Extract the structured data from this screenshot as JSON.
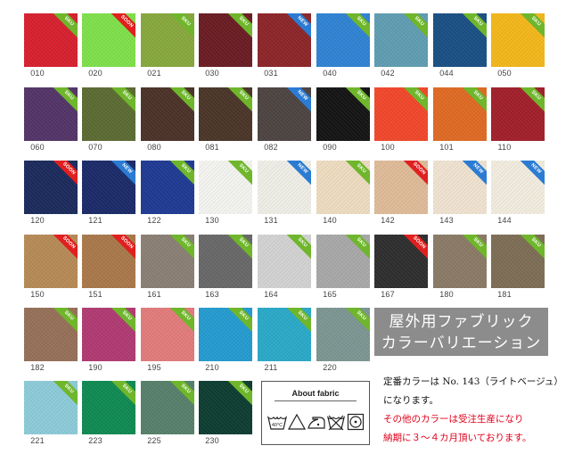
{
  "swatches": [
    {
      "code": "010",
      "color": "#d7202f",
      "tag": "SKU"
    },
    {
      "code": "020",
      "color": "#7fe04a",
      "tag": "SOON"
    },
    {
      "code": "021",
      "color": "#87a83c",
      "tag": "SKU"
    },
    {
      "code": "030",
      "color": "#6a1c23",
      "tag": "SKU"
    },
    {
      "code": "031",
      "color": "#8c2528",
      "tag": "NEW"
    },
    {
      "code": "040",
      "color": "#2f83d3",
      "tag": "SKU"
    },
    {
      "code": "042",
      "color": "#5f9db2",
      "tag": "SKU"
    },
    {
      "code": "044",
      "color": "#1a4f84",
      "tag": "SKU"
    },
    {
      "code": "050",
      "color": "#f3b71b",
      "tag": "SKU"
    },
    {
      "code": "060",
      "color": "#533468",
      "tag": "SKU"
    },
    {
      "code": "070",
      "color": "#5b6b32",
      "tag": "SKU"
    },
    {
      "code": "080",
      "color": "#4b3228",
      "tag": "SKU"
    },
    {
      "code": "081",
      "color": "#4a3528",
      "tag": "SKU"
    },
    {
      "code": "082",
      "color": "#4d4442",
      "tag": "NEW"
    },
    {
      "code": "090",
      "color": "#141414",
      "tag": "SKU"
    },
    {
      "code": "100",
      "color": "#f1472b",
      "tag": "SKU"
    },
    {
      "code": "101",
      "color": "#df6a23",
      "tag": "SKU"
    },
    {
      "code": "110",
      "color": "#a11f2a",
      "tag": "SKU"
    },
    {
      "code": "120",
      "color": "#1b2a5c",
      "tag": "SOON"
    },
    {
      "code": "121",
      "color": "#1b2a69",
      "tag": "NEW"
    },
    {
      "code": "122",
      "color": "#1f3a93",
      "tag": "SKU"
    },
    {
      "code": "130",
      "color": "#f3f3ef",
      "tag": "SKU"
    },
    {
      "code": "131",
      "color": "#efeee6",
      "tag": "NEW"
    },
    {
      "code": "140",
      "color": "#eddcc0",
      "tag": "SKU"
    },
    {
      "code": "142",
      "color": "#dfbb98",
      "tag": "SOON"
    },
    {
      "code": "143",
      "color": "#efe2d0",
      "tag": "NEW"
    },
    {
      "code": "144",
      "color": "#f2ecdf",
      "tag": "NEW"
    },
    {
      "code": "150",
      "color": "#b78a56",
      "tag": "SOON"
    },
    {
      "code": "151",
      "color": "#a9784a",
      "tag": "SOON"
    },
    {
      "code": "161",
      "color": "#8a7f74",
      "tag": "SKU"
    },
    {
      "code": "163",
      "color": "#686868",
      "tag": "SKU"
    },
    {
      "code": "164",
      "color": "#d2d2d2",
      "tag": "SKU"
    },
    {
      "code": "165",
      "color": "#a8a8a8",
      "tag": "SKU"
    },
    {
      "code": "167",
      "color": "#2e2e2e",
      "tag": "SOON"
    },
    {
      "code": "180",
      "color": "#8a7a66",
      "tag": "SKU"
    },
    {
      "code": "181",
      "color": "#7d6d55",
      "tag": "SKU"
    },
    {
      "code": "182",
      "color": "#967058",
      "tag": "SKU"
    },
    {
      "code": "190",
      "color": "#b03a72",
      "tag": "SKU"
    },
    {
      "code": "195",
      "color": "#e27b7b",
      "tag": "SKU"
    },
    {
      "code": "210",
      "color": "#249bcf",
      "tag": "SKU"
    },
    {
      "code": "211",
      "color": "#2aa9c8",
      "tag": "SKU"
    },
    {
      "code": "220",
      "color": "#7c9692",
      "tag": "SKU"
    },
    {
      "code": "221",
      "color": "#8ccbd8",
      "tag": "SKU"
    },
    {
      "code": "223",
      "color": "#0f8a52",
      "tag": "SKU"
    },
    {
      "code": "225",
      "color": "#56806a",
      "tag": "SKU"
    },
    {
      "code": "230",
      "color": "#0e3d31",
      "tag": "SKU"
    }
  ],
  "tag_colors": {
    "SKU": "#6fb62c",
    "NEW": "#2b7bd3",
    "SOON": "#e02020"
  },
  "title": {
    "line1": "屋外用ファブリック",
    "line2": "カラーバリエーション"
  },
  "about": {
    "title": "About fabric",
    "wash_temp": "40°C"
  },
  "note": {
    "line1": "定番カラーは No. 143（ライトベージュ）",
    "line2": "になります。",
    "line3": "その他のカラーは受注生産になり",
    "line4": "納期に３～４カ月頂いております。"
  }
}
